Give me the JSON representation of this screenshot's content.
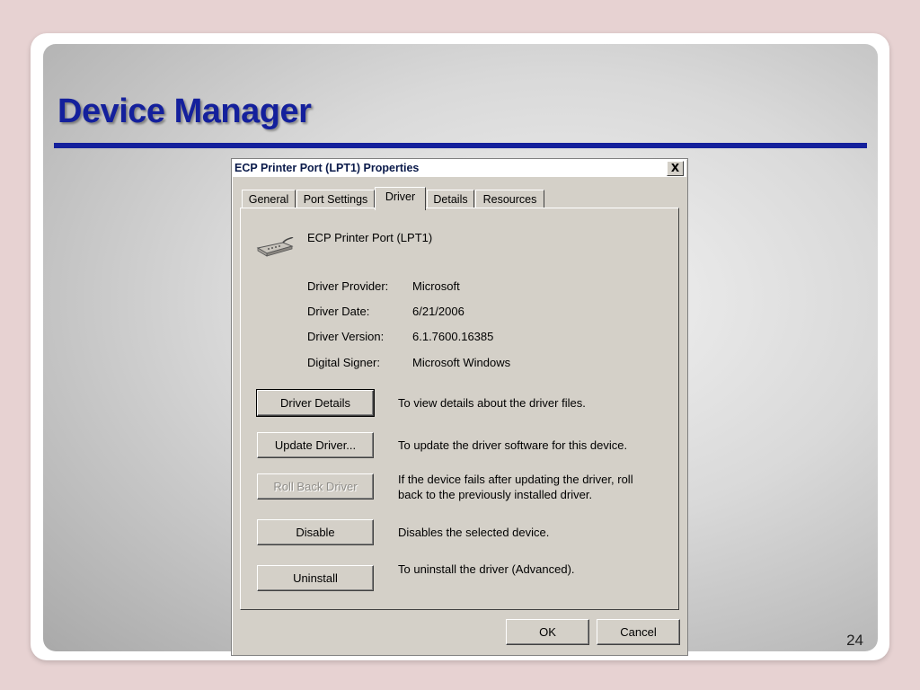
{
  "slide": {
    "title": "Device Manager",
    "page_number": "24"
  },
  "dialog": {
    "title": "ECP Printer Port (LPT1) Properties",
    "close_label": "X",
    "tabs": [
      {
        "label": "General",
        "active": false
      },
      {
        "label": "Port Settings",
        "active": false
      },
      {
        "label": "Driver",
        "active": true
      },
      {
        "label": "Details",
        "active": false
      },
      {
        "label": "Resources",
        "active": false
      }
    ],
    "device": {
      "name": "ECP Printer Port (LPT1)",
      "icon": "printer-port-icon"
    },
    "info": [
      {
        "label": "Driver Provider:",
        "value": "Microsoft"
      },
      {
        "label": "Driver Date:",
        "value": "6/21/2006"
      },
      {
        "label": "Driver Version:",
        "value": "6.1.7600.16385"
      },
      {
        "label": "Digital Signer:",
        "value": "Microsoft Windows"
      }
    ],
    "actions": [
      {
        "label": "Driver Details",
        "description": "To view details about the driver files.",
        "enabled": true
      },
      {
        "label": "Update Driver...",
        "description": "To update the driver software for this device.",
        "enabled": true
      },
      {
        "label": "Roll Back Driver",
        "description": "If the device fails after updating the driver, roll back to the previously installed driver.",
        "enabled": false
      },
      {
        "label": "Disable",
        "description": "Disables the selected device.",
        "enabled": true
      },
      {
        "label": "Uninstall",
        "description": "To uninstall the driver (Advanced).",
        "enabled": true
      }
    ],
    "footer": {
      "ok_label": "OK",
      "cancel_label": "Cancel"
    }
  },
  "colors": {
    "title_blue": "#14209c",
    "dialog_face": "#d4d0c8",
    "page_background": "#e7d2d2"
  }
}
